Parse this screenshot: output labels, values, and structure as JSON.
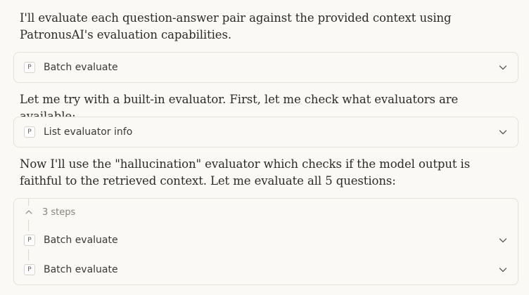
{
  "messages": {
    "intro": "I'll evaluate each question-answer pair against the provided context using PatronusAI's evaluation capabilities.",
    "builtin": "Let me try with a built-in evaluator. First, let me check what evaluators are available:",
    "hallucination": "Now I'll use the \"hallucination\" evaluator which checks if the model output is faithful to the retrieved context. Let me evaluate all 5 questions:"
  },
  "tools": {
    "batch_evaluate_1": {
      "badge": "P",
      "label": "Batch evaluate"
    },
    "list_evaluator_info": {
      "badge": "P",
      "label": "List evaluator info"
    }
  },
  "steps_group": {
    "label": "3 steps",
    "items": [
      {
        "badge": "P",
        "label": "Batch evaluate"
      },
      {
        "badge": "P",
        "label": "Batch evaluate"
      }
    ]
  },
  "icons": {
    "tool_provider": "patronus-p-icon",
    "expand": "chevron-down-icon",
    "collapse": "chevron-up-icon"
  },
  "colors": {
    "background": "#faf9f5",
    "border": "#e3e1d8",
    "text": "#2b2a27",
    "muted": "#86847e"
  }
}
